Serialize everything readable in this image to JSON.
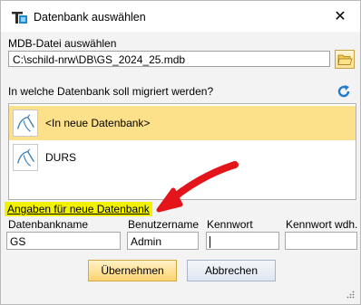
{
  "window": {
    "title": "Datenbank auswählen"
  },
  "mdb": {
    "label": "MDB-Datei auswählen",
    "path": "C:\\schild-nrw\\DB\\GS_2024_25.mdb"
  },
  "migrate": {
    "question": "In welche Datenbank soll migriert werden?",
    "items": [
      {
        "label": "<In neue Datenbank>"
      },
      {
        "label": "DURS"
      }
    ]
  },
  "section": {
    "title": "Angaben für neue Datenbank"
  },
  "fields": {
    "db_name_label": "Datenbankname",
    "db_name_value": "GS",
    "user_label": "Benutzername",
    "user_value": "Admin",
    "password_label": "Kennwort",
    "password_value": "",
    "password_repeat_label": "Kennwort wdh.",
    "password_repeat_value": ""
  },
  "buttons": {
    "ok": "Übernehmen",
    "cancel": "Abbrechen"
  },
  "colors": {
    "selection": "#fde08a",
    "highlight": "#f2f100",
    "arrow": "#e4141b"
  }
}
